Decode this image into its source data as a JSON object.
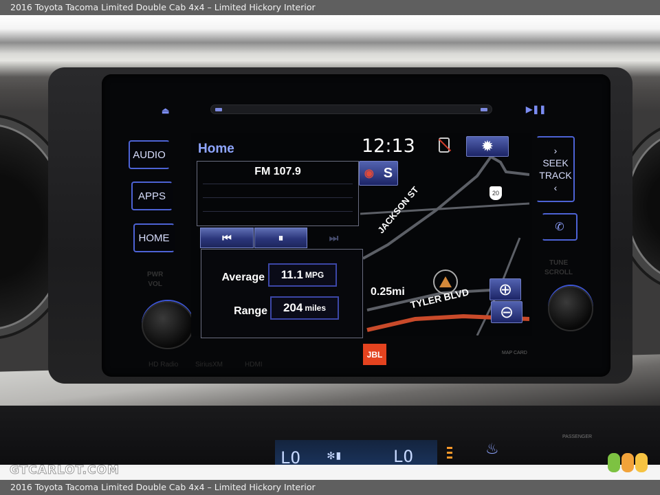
{
  "caption": {
    "top": "2016 Toyota Tacoma Limited Double Cab 4x4 – Limited Hickory Interior",
    "bottom": "2016 Toyota Tacoma Limited Double Cab 4x4 – Limited Hickory Interior"
  },
  "head_unit": {
    "left_buttons": [
      "AUDIO",
      "APPS",
      "HOME"
    ],
    "pwr_vol_label": [
      "PWR",
      "VOL"
    ],
    "tune_scroll_label": [
      "TUNE",
      "SCROLL"
    ],
    "seek_track": {
      "line1": "SEEK",
      "line2": "TRACK",
      "up_icon": "chevron-right-icon",
      "down_icon": "chevron-left-icon"
    },
    "eject_icon": "eject-icon",
    "play_pause_icon": "play-pause-icon",
    "phone_icon": "phone-icon",
    "brand_badge": "JBL",
    "sd_label": "MAP CARD",
    "source_labels": [
      "HD Radio",
      "SiriusXM",
      "HDMI"
    ]
  },
  "screen": {
    "title": "Home",
    "clock": "12:13",
    "radio": {
      "station": "FM 107.9",
      "controls": [
        {
          "name": "previous",
          "glyph": "⏮",
          "enabled": true
        },
        {
          "name": "pause",
          "glyph": "⏸",
          "enabled": true
        },
        {
          "name": "next",
          "glyph": "⏭",
          "enabled": false
        }
      ]
    },
    "eco": {
      "average_label": "Average",
      "average_value": "11.1",
      "average_unit": "MPG",
      "range_label": "Range",
      "range_value": "204",
      "range_unit": "miles"
    },
    "map": {
      "heading": "S",
      "distance_scale": "0.25mi",
      "streets": [
        "JACKSON ST",
        "TYLER BLVD"
      ],
      "route_shield": "20",
      "zoom_in_glyph": "⊕",
      "zoom_out_glyph": "⊖",
      "settings_glyph": "✹",
      "route_color": "#c94a2a"
    }
  },
  "hvac": {
    "left_temp": "LO",
    "right_temp": "LO",
    "passenger_label": "PASSENGER"
  },
  "watermark": "GTCARLOT.COM",
  "logo_colors": [
    "#7dc242",
    "#f2a33a",
    "#f6c342"
  ]
}
